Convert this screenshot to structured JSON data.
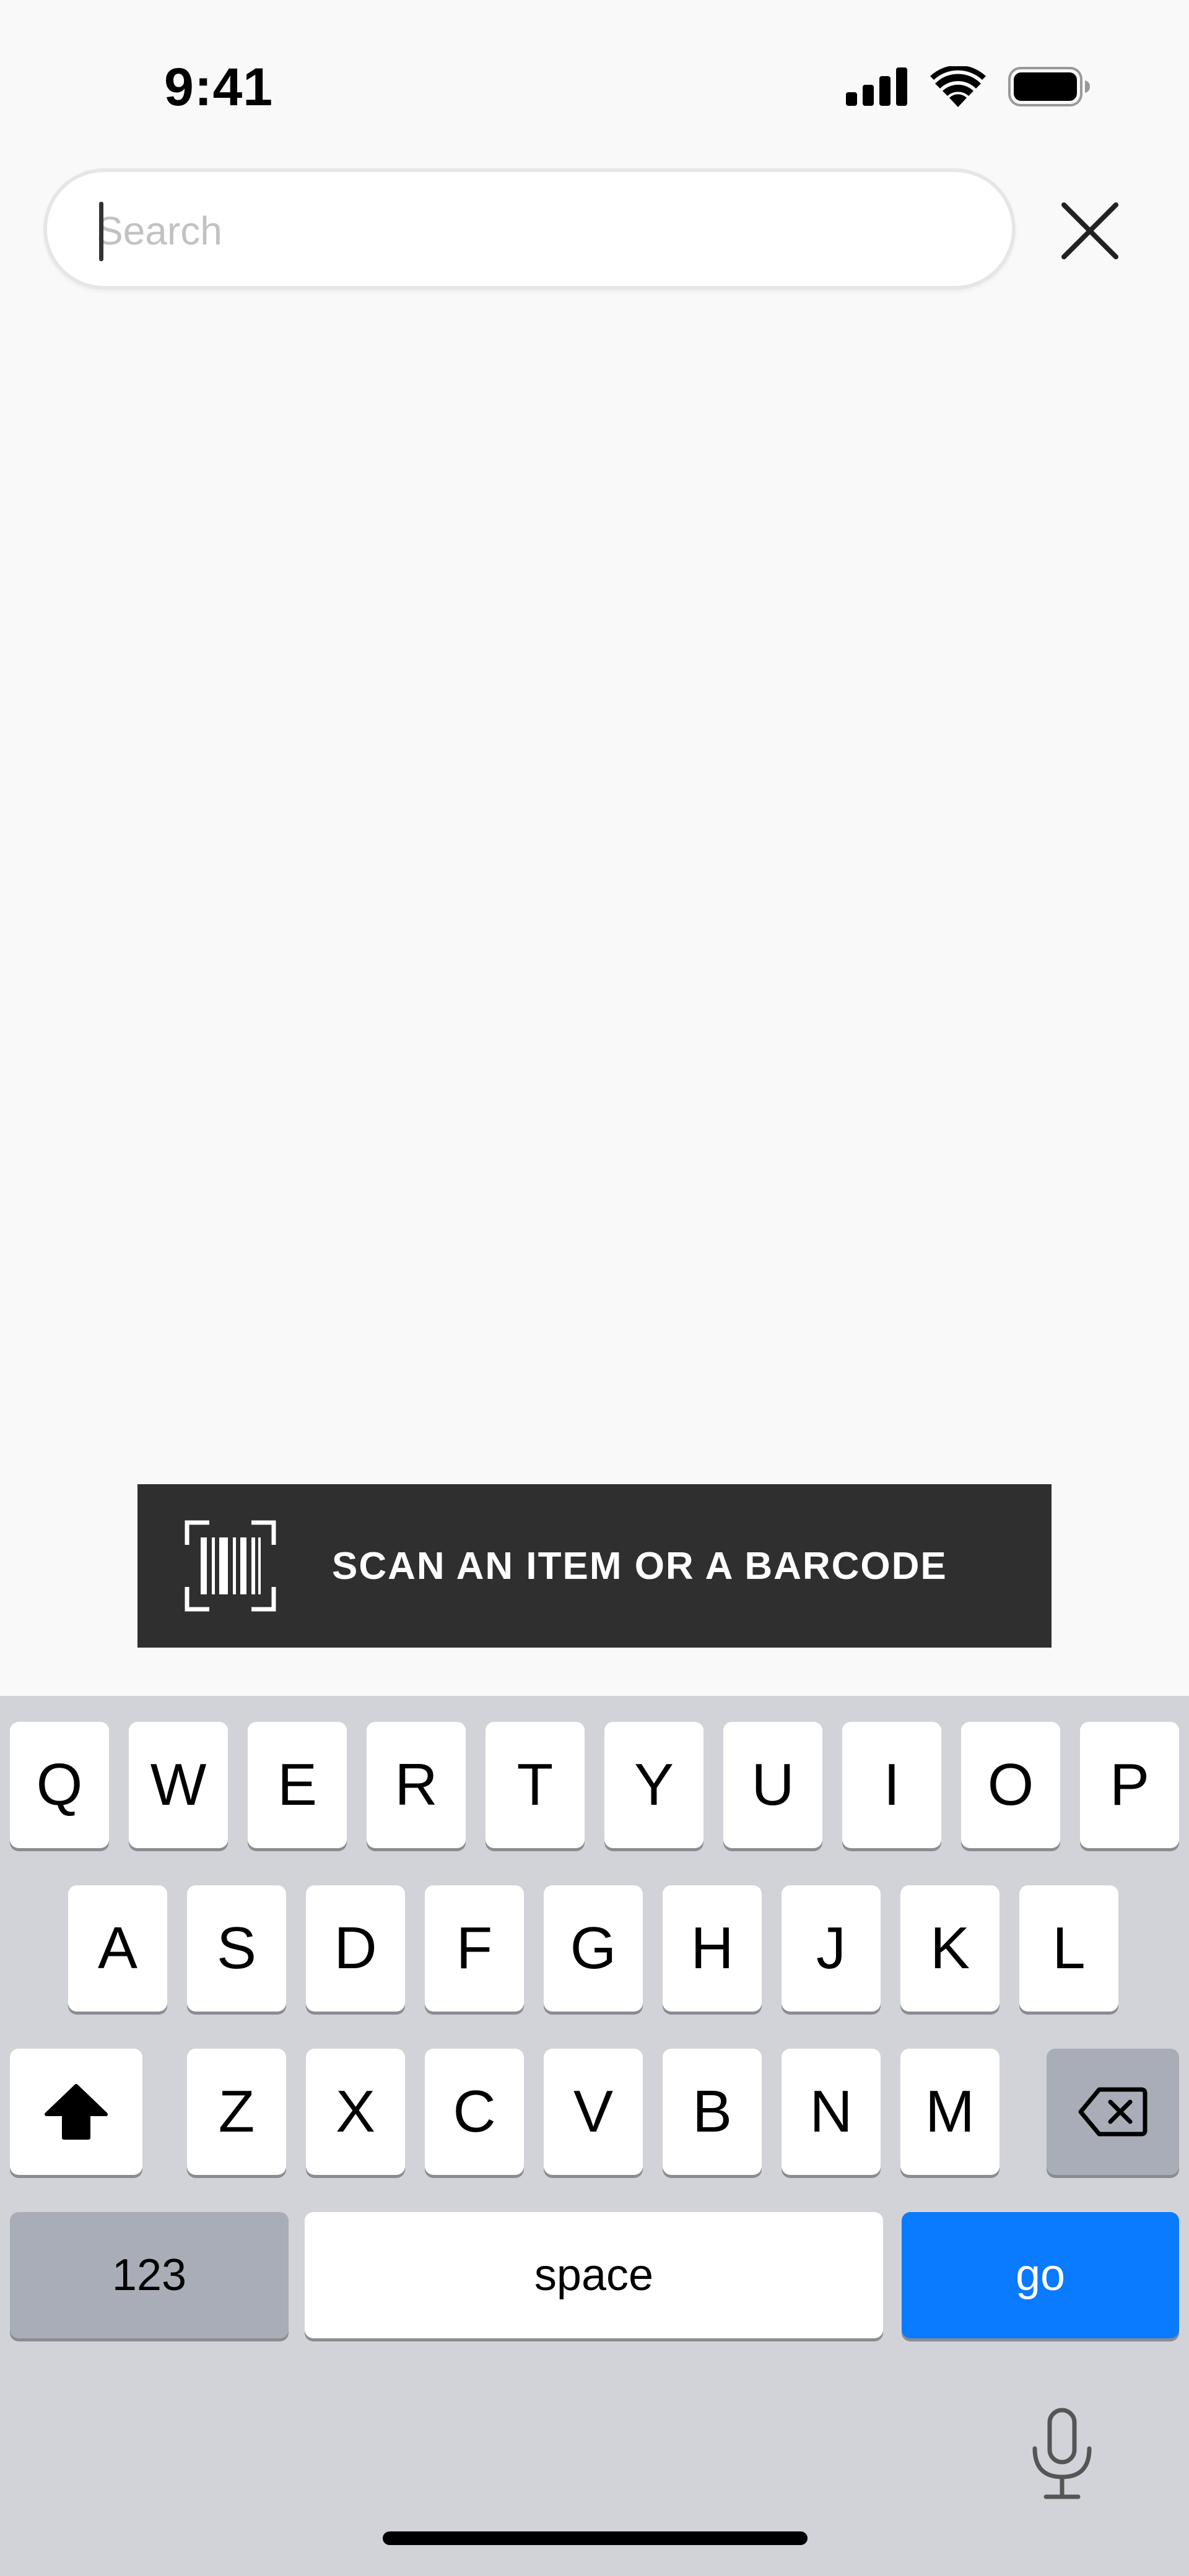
{
  "status_bar": {
    "time": "9:41"
  },
  "search": {
    "placeholder": "Search",
    "value": ""
  },
  "scan_banner": {
    "label": "SCAN AN ITEM OR A BARCODE"
  },
  "keyboard": {
    "row1": [
      "Q",
      "W",
      "E",
      "R",
      "T",
      "Y",
      "U",
      "I",
      "O",
      "P"
    ],
    "row2": [
      "A",
      "S",
      "D",
      "F",
      "G",
      "H",
      "J",
      "K",
      "L"
    ],
    "row3": [
      "Z",
      "X",
      "C",
      "V",
      "B",
      "N",
      "M"
    ],
    "numbers_label": "123",
    "space_label": "space",
    "go_label": "go"
  },
  "colors": {
    "background": "#f9f9f9",
    "banner": "#2f2f2f",
    "keyboard": "#d2d3d8",
    "go_key": "#0a7aff"
  },
  "icons": [
    "signal-icon",
    "wifi-icon",
    "battery-icon",
    "close-icon",
    "barcode-scan-icon",
    "shift-icon",
    "delete-icon",
    "microphone-icon"
  ]
}
